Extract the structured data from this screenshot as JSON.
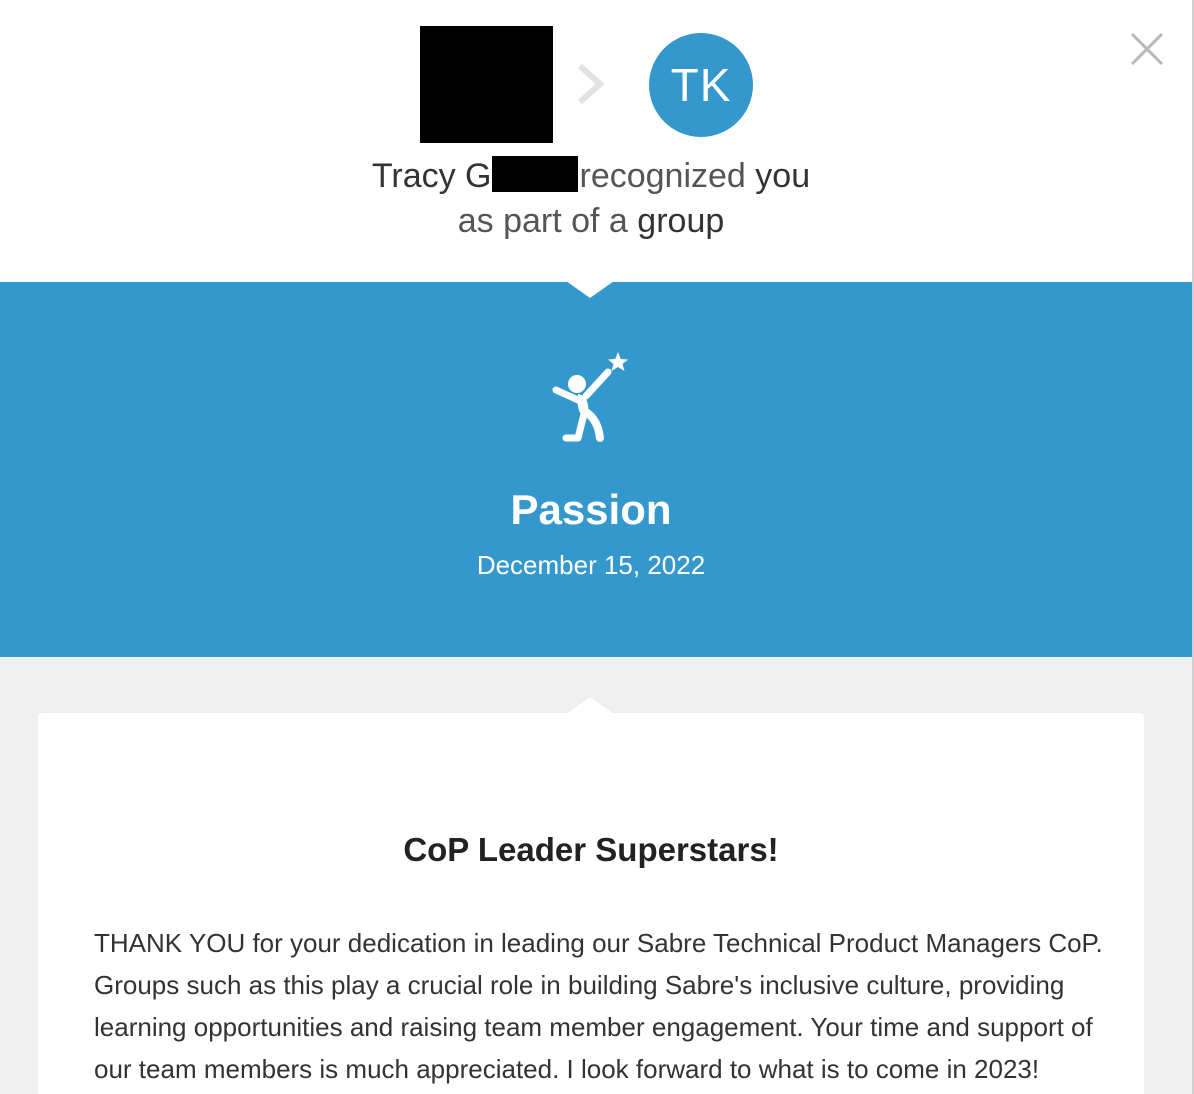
{
  "header": {
    "recipient_initials": "TK",
    "headline_name": "Tracy G",
    "headline_verb": "recognized",
    "headline_you": "you",
    "headline_line2_prefix": "as part of a",
    "headline_group": "group"
  },
  "icons": {
    "close": "close-icon",
    "arrow": "chevron-right-icon",
    "value": "reaching-star-icon"
  },
  "award": {
    "value_name": "Passion",
    "date": "December 15, 2022"
  },
  "message": {
    "title": "CoP Leader Superstars!",
    "body": "THANK YOU for your dedication in leading our Sabre Technical Product Managers CoP. Groups such as this play a crucial role in building Sabre's inclusive culture, providing learning opportunities and raising team member engagement. Your time and support of our team members is much appreciated. I look forward to what is to come in 2023!"
  },
  "colors": {
    "accent": "#3498cc",
    "background_gray": "#efefef"
  }
}
